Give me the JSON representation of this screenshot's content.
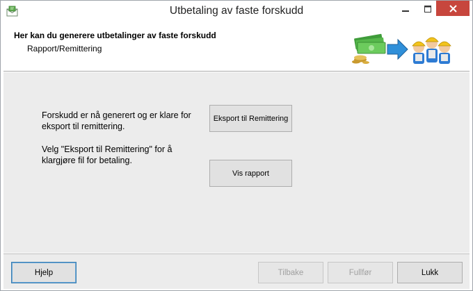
{
  "window": {
    "title": "Utbetaling av faste forskudd"
  },
  "titlebar": {
    "icons": [
      "envelope-app-icon",
      "minimize-icon",
      "maximize-icon",
      "close-icon"
    ]
  },
  "header": {
    "title": "Her kan du generere utbetalinger av faste forskudd",
    "subtitle": "Rapport/Remittering",
    "graphic": "money-to-workers-illustration"
  },
  "content": {
    "info1": "Forskudd er nå generert og er klare for eksport til remittering.",
    "info2": "Velg \"Eksport til Remittering\" for å klargjøre fil for betaling.",
    "export_button": "Eksport til Remittering",
    "report_button": "Vis rapport"
  },
  "footer": {
    "help_label": "Hjelp",
    "back_label": "Tilbake",
    "finish_label": "Fullfør",
    "close_label": "Lukk"
  },
  "colors": {
    "close_button_bg": "#c7463d",
    "content_bg": "#ececec",
    "button_bg": "#e1e1e1",
    "focus_border": "#3c7fb1",
    "disabled_text": "#a0a0a0"
  }
}
